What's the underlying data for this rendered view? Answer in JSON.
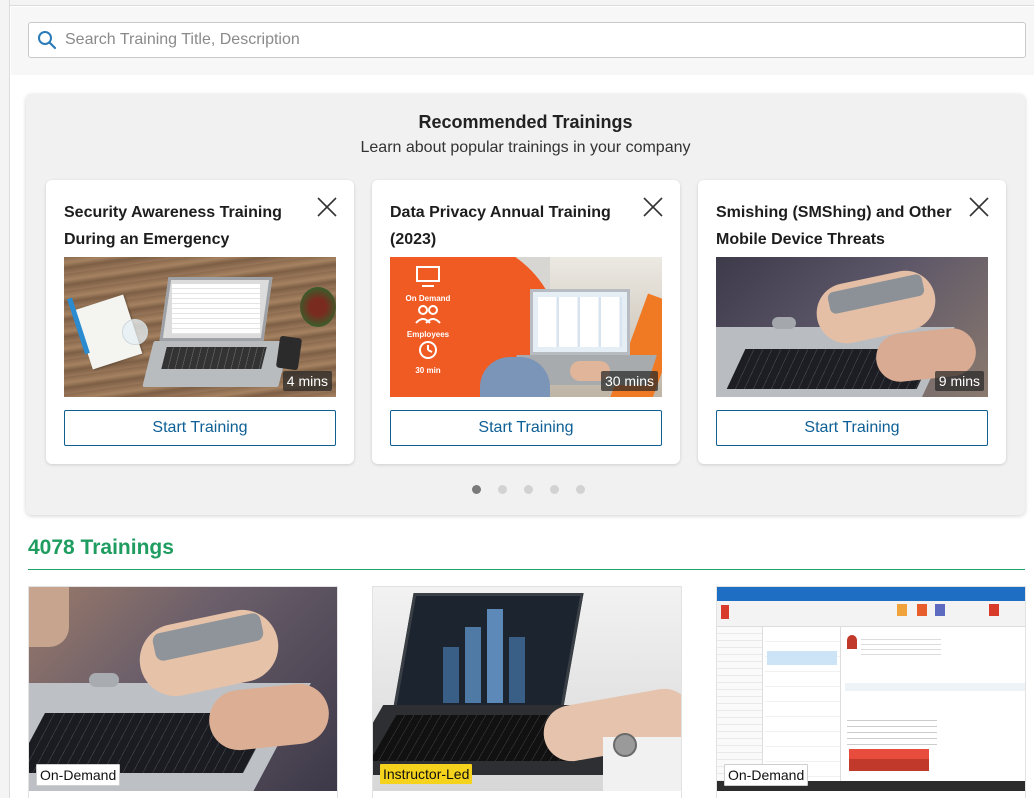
{
  "search": {
    "placeholder": "Search Training Title, Description"
  },
  "recommended": {
    "title": "Recommended Trainings",
    "subtitle": "Learn about popular trainings in your company",
    "cards": [
      {
        "title": "Security Awareness Training During an Emergency",
        "duration": "4 mins",
        "button": "Start Training"
      },
      {
        "title": "Data Privacy Annual Training (2023)",
        "duration": "30 mins",
        "button": "Start Training",
        "image_text": [
          "On Demand",
          "Employees",
          "30 min"
        ]
      },
      {
        "title": "Smishing (SMShing) and Other Mobile Device Threats",
        "duration": "9 mins",
        "button": "Start Training"
      }
    ],
    "carousel": {
      "pages": 5,
      "active": 0
    }
  },
  "trainings": {
    "count_label": "4078 Trainings",
    "cards": [
      {
        "type": "On-Demand",
        "tag_style": "ondemand"
      },
      {
        "type": "Instructor-Led",
        "tag_style": "instructor"
      },
      {
        "type": "On-Demand",
        "tag_style": "ondemand"
      }
    ]
  },
  "colors": {
    "accent_green": "#1f9d61",
    "button_blue": "#0d5f95",
    "instructor_tag": "#f5d21c",
    "orange_banner": "#f05a23"
  },
  "icons": {
    "search": "search-icon",
    "close": "close-icon"
  }
}
